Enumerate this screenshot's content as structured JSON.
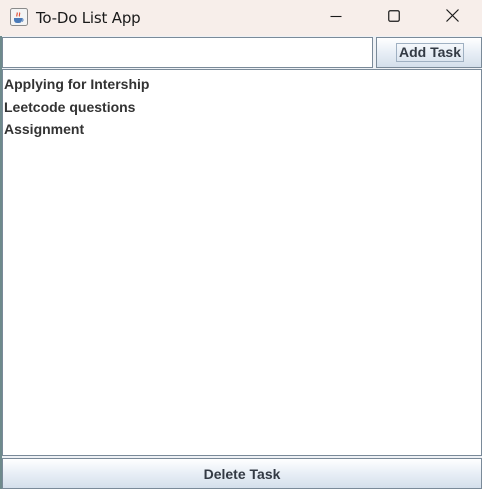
{
  "window": {
    "title": "To-Do List App",
    "icon": "java-cup-icon"
  },
  "window_controls": {
    "minimize_icon": "minimize-icon",
    "maximize_icon": "maximize-icon",
    "close_icon": "close-icon"
  },
  "input": {
    "value": "",
    "placeholder": ""
  },
  "buttons": {
    "add_task": "Add Task",
    "delete_task": "Delete Task"
  },
  "tasks": [
    "Applying for Intership",
    "Leetcode questions",
    "Assignment"
  ],
  "colors": {
    "titlebar": "#f7eeea",
    "border": "#7a8a99",
    "button_top": "#ffffff",
    "button_bottom": "#d4dfeb",
    "text": "#333333"
  }
}
